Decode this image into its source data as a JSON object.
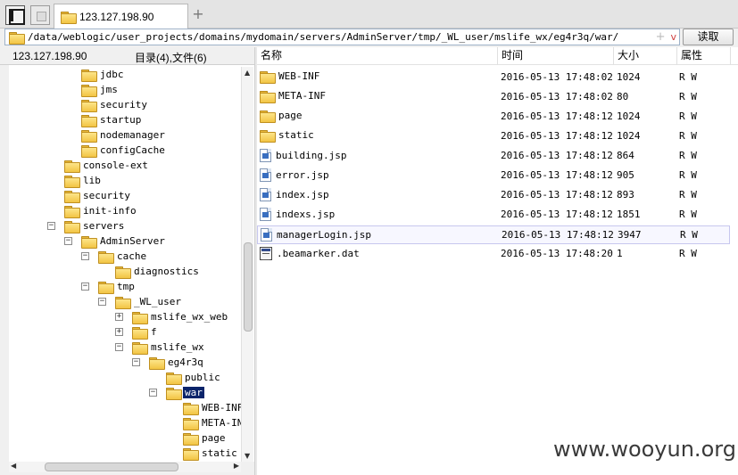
{
  "tab": {
    "title": "123.127.198.90",
    "add_label": "+"
  },
  "address": {
    "path": "/data/weblogic/user_projects/domains/mydomain/servers/AdminServer/tmp/_WL_user/mslife_wx/eg4r3q/war/",
    "plus": "+",
    "chevron": "v",
    "read_button": "读取"
  },
  "left_header": {
    "host": "123.127.198.90",
    "counts": "目录(4),文件(6)"
  },
  "tree": [
    {
      "label": "jdbc",
      "depth": 5,
      "expander": ""
    },
    {
      "label": "jms",
      "depth": 5,
      "expander": ""
    },
    {
      "label": "security",
      "depth": 5,
      "expander": ""
    },
    {
      "label": "startup",
      "depth": 5,
      "expander": ""
    },
    {
      "label": "nodemanager",
      "depth": 5,
      "expander": ""
    },
    {
      "label": "configCache",
      "depth": 5,
      "expander": ""
    },
    {
      "label": "console-ext",
      "depth": 4,
      "expander": ""
    },
    {
      "label": "lib",
      "depth": 4,
      "expander": ""
    },
    {
      "label": "security",
      "depth": 4,
      "expander": ""
    },
    {
      "label": "init-info",
      "depth": 4,
      "expander": ""
    },
    {
      "label": "servers",
      "depth": 4,
      "expander": "−"
    },
    {
      "label": "AdminServer",
      "depth": 5,
      "expander": "−"
    },
    {
      "label": "cache",
      "depth": 6,
      "expander": "−"
    },
    {
      "label": "diagnostics",
      "depth": 7,
      "expander": ""
    },
    {
      "label": "tmp",
      "depth": 6,
      "expander": "−"
    },
    {
      "label": "_WL_user",
      "depth": 7,
      "expander": "−"
    },
    {
      "label": "mslife_wx_web",
      "depth": 8,
      "expander": "+"
    },
    {
      "label": "f",
      "depth": 8,
      "expander": "+"
    },
    {
      "label": "mslife_wx",
      "depth": 8,
      "expander": "−"
    },
    {
      "label": "eg4r3q",
      "depth": 9,
      "expander": "−"
    },
    {
      "label": "public",
      "depth": 10,
      "expander": ""
    },
    {
      "label": "war",
      "depth": 10,
      "expander": "−",
      "selected": true
    },
    {
      "label": "WEB-INF",
      "depth": 11,
      "expander": ""
    },
    {
      "label": "META-INF",
      "depth": 11,
      "expander": ""
    },
    {
      "label": "page",
      "depth": 11,
      "expander": ""
    },
    {
      "label": "static",
      "depth": 11,
      "expander": ""
    }
  ],
  "columns": {
    "name": "名称",
    "time": "时间",
    "size": "大小",
    "attr": "属性"
  },
  "files": [
    {
      "name": "WEB-INF",
      "type": "folder",
      "time": "2016-05-13 17:48:02",
      "size": "1024",
      "attr": "R W"
    },
    {
      "name": "META-INF",
      "type": "folder",
      "time": "2016-05-13 17:48:02",
      "size": "80",
      "attr": "R W"
    },
    {
      "name": "page",
      "type": "folder",
      "time": "2016-05-13 17:48:12",
      "size": "1024",
      "attr": "R W"
    },
    {
      "name": "static",
      "type": "folder",
      "time": "2016-05-13 17:48:12",
      "size": "1024",
      "attr": "R W"
    },
    {
      "name": "building.jsp",
      "type": "file",
      "time": "2016-05-13 17:48:12",
      "size": "864",
      "attr": "R W"
    },
    {
      "name": "error.jsp",
      "type": "file",
      "time": "2016-05-13 17:48:12",
      "size": "905",
      "attr": "R W"
    },
    {
      "name": "index.jsp",
      "type": "file",
      "time": "2016-05-13 17:48:12",
      "size": "893",
      "attr": "R W"
    },
    {
      "name": "indexs.jsp",
      "type": "file",
      "time": "2016-05-13 17:48:12",
      "size": "1851",
      "attr": "R W"
    },
    {
      "name": "managerLogin.jsp",
      "type": "file",
      "time": "2016-05-13 17:48:12",
      "size": "3947",
      "attr": "R W",
      "hover": true
    },
    {
      "name": ".beamarker.dat",
      "type": "dat",
      "time": "2016-05-13 17:48:20",
      "size": "1",
      "attr": "R W"
    }
  ],
  "watermark": "www.wooyun.org"
}
